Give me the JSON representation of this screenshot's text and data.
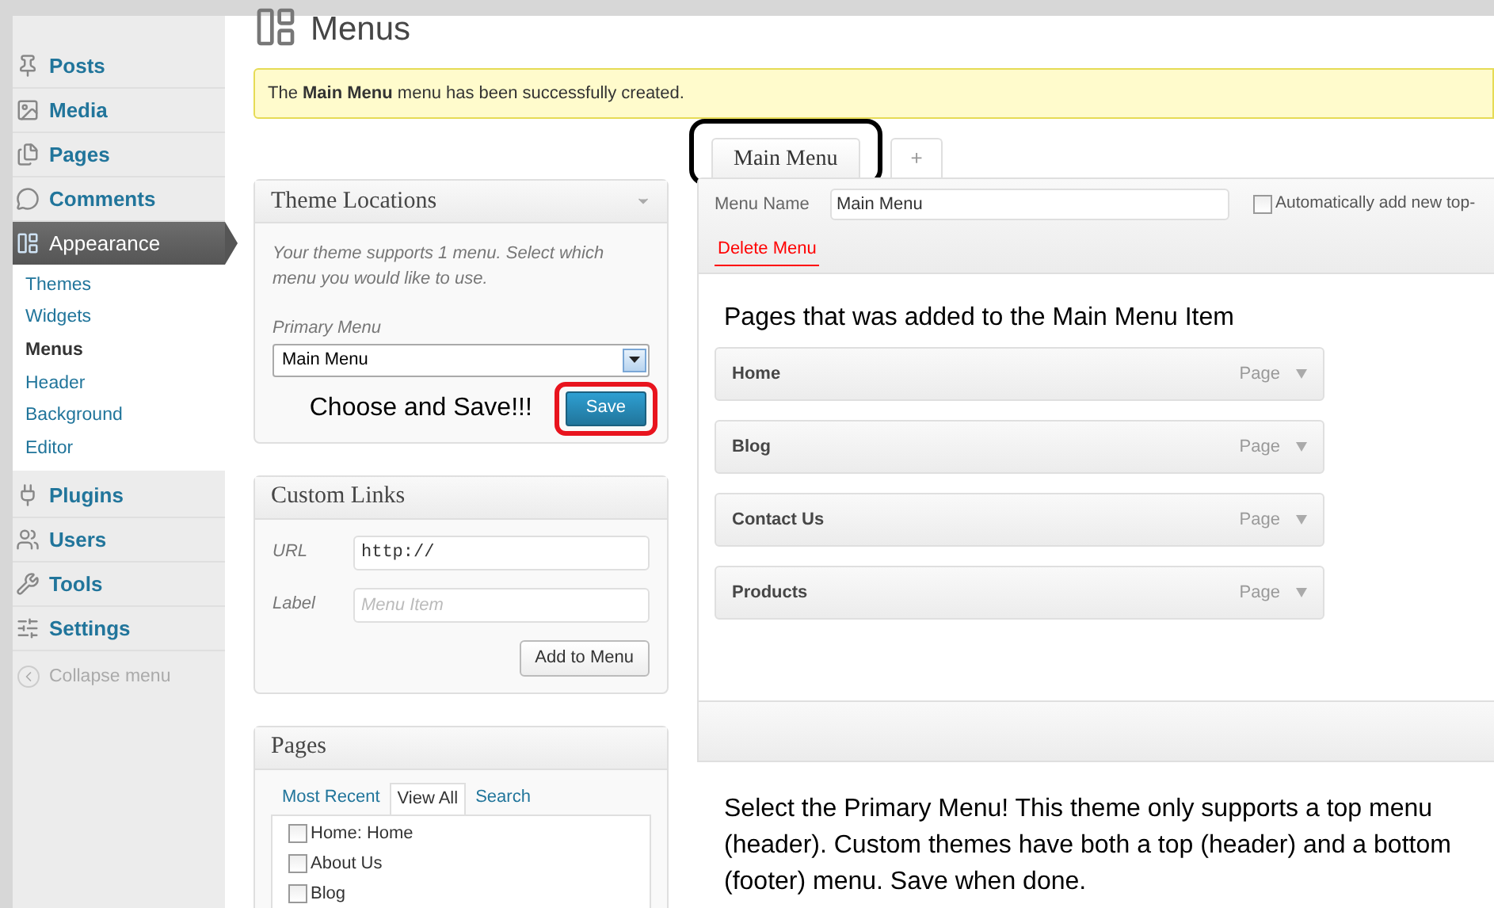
{
  "sidebar": {
    "items": [
      {
        "label": "Posts",
        "selected": false
      },
      {
        "label": "Media",
        "selected": false
      },
      {
        "label": "Pages",
        "selected": false
      },
      {
        "label": "Comments",
        "selected": false
      },
      {
        "label": "Appearance",
        "selected": true,
        "children": [
          {
            "label": "Themes",
            "selected": false
          },
          {
            "label": "Widgets",
            "selected": false
          },
          {
            "label": "Menus",
            "selected": true
          },
          {
            "label": "Header",
            "selected": false
          },
          {
            "label": "Background",
            "selected": false
          },
          {
            "label": "Editor",
            "selected": false
          }
        ]
      },
      {
        "label": "Plugins",
        "selected": false
      },
      {
        "label": "Users",
        "selected": false
      },
      {
        "label": "Tools",
        "selected": false
      },
      {
        "label": "Settings",
        "selected": false
      }
    ],
    "collapse": "Collapse menu"
  },
  "page_title": "Menus",
  "notice": "The **Main Menu** menu has been successfully created.",
  "theme_locations": {
    "title": "Theme Locations",
    "description": "Your theme supports 1 menu. Select which menu you would like to use.",
    "field_label": "Primary Menu",
    "select_value": "Main Menu",
    "annotation": "Choose and Save!!!",
    "save_button": "Save"
  },
  "custom_links": {
    "title": "Custom Links",
    "url_label": "URL",
    "url_value": "http://",
    "label_label": "Label",
    "label_placeholder": "Menu Item",
    "button": "Add to Menu"
  },
  "pages_box": {
    "title": "Pages",
    "tabs": [
      {
        "label": "Most Recent",
        "selected": false
      },
      {
        "label": "View All",
        "selected": true
      },
      {
        "label": "Search",
        "selected": false
      }
    ],
    "items": [
      {
        "label": "Home: Home",
        "checked": false
      },
      {
        "label": "About Us",
        "checked": false
      },
      {
        "label": "Blog",
        "checked": false
      }
    ]
  },
  "menu_editor": {
    "tabs": [
      {
        "label": "Main Menu",
        "selected": true
      },
      {
        "label": "+",
        "selected": false
      }
    ],
    "menu_name_label": "Menu Name",
    "menu_name_value": "Main Menu",
    "auto_add": {
      "label": "Automatically add new top-",
      "checked": false
    },
    "delete_link": "Delete Menu",
    "annotation": "Pages that was added to the Main Menu Item",
    "items": [
      {
        "label": "Home",
        "type": "Page"
      },
      {
        "label": "Blog",
        "type": "Page"
      },
      {
        "label": "Contact Us",
        "type": "Page"
      },
      {
        "label": "Products",
        "type": "Page"
      }
    ]
  },
  "bottom_note": "Select the Primary Menu! This theme only supports a top menu (header). Custom themes have both a top (header) and a bottom (footer) menu. Save when done."
}
